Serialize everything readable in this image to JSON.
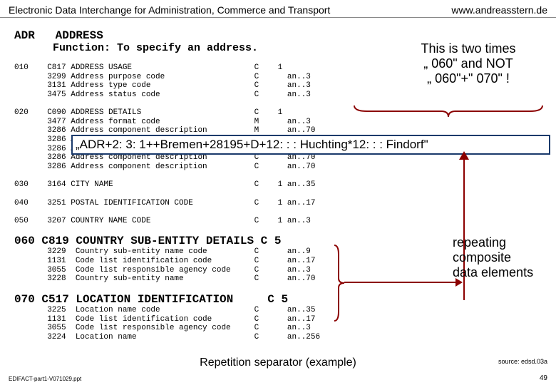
{
  "header": {
    "left": "Electronic Data Interchange for Administration, Commerce and Transport",
    "right": "www.andreasstern.de"
  },
  "spec": {
    "head": "ADR   ADDRESS",
    "func": "      Function: To specify an address.",
    "g010": [
      "010    C817 ADDRESS USAGE                          C    1",
      "       3299 Address purpose code                   C      an..3",
      "       3131 Address type code                      C      an..3",
      "       3475 Address status code                    C      an..3"
    ],
    "g020": [
      "020    C090 ADDRESS DETAILS                        C    1",
      "       3477 Address format code                    M      an..3",
      "       3286 Address component description          M      an..70",
      "       3286 Address component description          C      an..70",
      "       3286 Address component description          C      an..70",
      "       3286 Address component description          C      an..70",
      "       3286 Address component description          C      an..70"
    ],
    "g030": "030    3164 CITY NAME                              C    1 an..35",
    "g040": "040    3251 POSTAL IDENTIFICATION CODE             C    1 an..17",
    "g050": "050    3207 COUNTRY NAME CODE                      C    1 an..3",
    "g060h": "060 C819 COUNTRY SUB-ENTITY DETAILS C 5",
    "g060": [
      "       3229  Country sub-entity name code          C      an..9",
      "       1131  Code list identification code         C      an..17",
      "       3055  Code list responsible agency code     C      an..3",
      "       3228  Country sub-entity name               C      an..70"
    ],
    "g070h": "070 C517 LOCATION IDENTIFICATION     C 5",
    "g070": [
      "       3225  Location name code                    C      an..35",
      "       1131  Code list identification code         C      an..17",
      "       3055  Code list responsible agency code     C      an..3",
      "       3224  Location name                         C      an..256"
    ]
  },
  "anno1": {
    "l1": "This is two times",
    "l2": "„ 060\" and NOT",
    "l3": "„ 060\"+\" 070\" !"
  },
  "example": "„ADR+2: 3: 1++Bremen+28195+D+12: : : Huchting*12: : : Findorf\"",
  "anno2": {
    "l1": "repeating",
    "l2": "composite",
    "l3": "data elements"
  },
  "footer": {
    "title": "Repetition separator (example)",
    "file": "EDIFACT-part1-V071029.ppt",
    "src": "source: edsd.03a",
    "page": "49"
  }
}
